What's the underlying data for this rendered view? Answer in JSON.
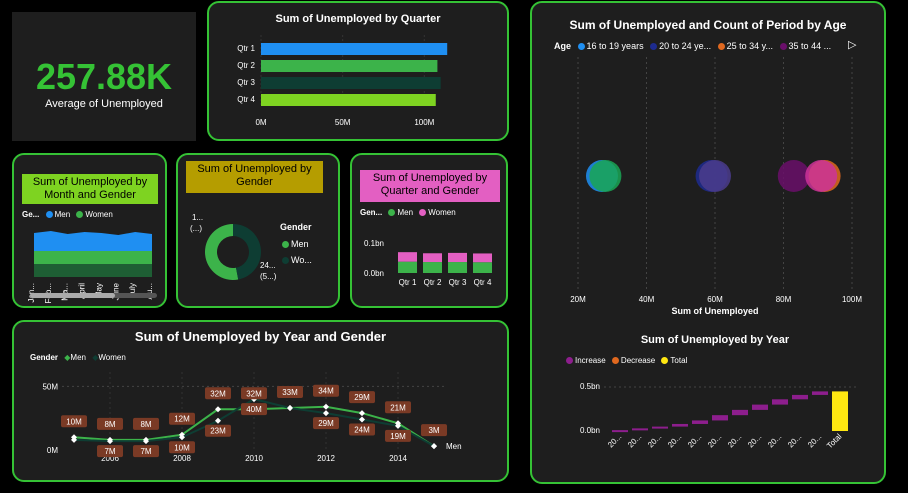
{
  "kpi": {
    "value": "257.88K",
    "label": "Average of Unemployed"
  },
  "colors": {
    "accent_green": "#35c235",
    "men": "#3cb34a",
    "women": "#0e3d33",
    "increase": "#8d1e8d",
    "decrease": "#e0681f",
    "total": "#ffe711"
  },
  "quarter_chart": {
    "title": "Sum of Unemployed by Quarter",
    "chart_data": {
      "type": "bar",
      "categories": [
        "Qtr 1",
        "Qtr 2",
        "Qtr 3",
        "Qtr 4"
      ],
      "values": [
        114,
        108,
        110,
        107
      ],
      "colors": [
        "#1f8ff2",
        "#3cb34a",
        "#0e3d33",
        "#7ed321"
      ],
      "xticks": [
        "0M",
        "50M",
        "100M"
      ],
      "xlim": [
        0,
        120
      ]
    }
  },
  "month_gender": {
    "title": "Sum of Unemployed by Month and Gender",
    "legend_title": "Ge...",
    "legend": [
      "Men",
      "Women"
    ],
    "months": [
      "Jan...",
      "Feb...",
      "Ma...",
      "April",
      "May",
      "June",
      "July",
      "Au..."
    ]
  },
  "donut": {
    "title": "Sum of Unemployed by Gender",
    "label_men": "24...",
    "label_men2": "(5...)",
    "label_women": "1...",
    "label_women2": "(...)",
    "legend_title": "Gender",
    "legend": [
      "Men",
      "Wo..."
    ],
    "chart_data": {
      "type": "pie",
      "categories": [
        "Men",
        "Women"
      ],
      "values": [
        53,
        47
      ]
    }
  },
  "qtr_gender": {
    "title": "Sum of Unemployed by Quarter and Gender",
    "legend_title": "Gen...",
    "legend": [
      "Men",
      "Women"
    ],
    "yticks": [
      "0.1bn",
      "0.0bn"
    ],
    "chart_data": {
      "type": "bar",
      "categories": [
        "Qtr 1",
        "Qtr 2",
        "Qtr 3",
        "Qtr 4"
      ],
      "series": [
        {
          "name": "Men",
          "values": [
            0.062,
            0.06,
            0.06,
            0.059
          ]
        },
        {
          "name": "Women",
          "values": [
            0.052,
            0.048,
            0.05,
            0.048
          ]
        }
      ]
    }
  },
  "bubble": {
    "title": "Sum of Unemployed and Count of Period by Age",
    "legend_title": "Age",
    "legend": [
      "16 to 19 years",
      "20 to 24 ye...",
      "25 to 34 y...",
      "35 to 44 ..."
    ],
    "xticks": [
      "20M",
      "40M",
      "60M",
      "80M",
      "100M"
    ],
    "xlabel": "Sum of Unemployed",
    "chart_data": {
      "type": "scatter",
      "xlim": [
        20,
        100
      ],
      "points": [
        {
          "x": 27,
          "y": 1,
          "color": "#1f8ff2"
        },
        {
          "x": 28,
          "y": 1,
          "color": "#1aa655"
        },
        {
          "x": 59,
          "y": 1,
          "color": "#1d2b8f"
        },
        {
          "x": 60,
          "y": 1,
          "color": "#4b3c8c"
        },
        {
          "x": 83,
          "y": 1,
          "color": "#6a0f6a"
        },
        {
          "x": 92,
          "y": 1,
          "color": "#e0681f"
        },
        {
          "x": 91,
          "y": 1,
          "color": "#cc3399"
        }
      ]
    }
  },
  "year_gender": {
    "title": "Sum of Unemployed by Year and Gender",
    "legend_title": "Gender",
    "legend": [
      "Men",
      "Women"
    ],
    "yticks": [
      "50M",
      "0M"
    ],
    "xticks": [
      "2006",
      "2008",
      "2010",
      "2012",
      "2014"
    ],
    "end_label": "Men",
    "chart_data": {
      "type": "line",
      "x": [
        2005,
        2006,
        2007,
        2008,
        2009,
        2010,
        2011,
        2012,
        2013,
        2014,
        2015
      ],
      "ylim": [
        0,
        55
      ],
      "series": [
        {
          "name": "Men",
          "values": [
            10,
            8,
            8,
            12,
            32,
            32,
            33,
            34,
            29,
            21,
            3
          ],
          "labels": [
            "10M",
            "8M",
            "8M",
            "12M",
            "32M",
            "32M",
            "33M",
            "34M",
            "29M",
            "21M",
            "3M"
          ]
        },
        {
          "name": "Women",
          "values": [
            8,
            7,
            7,
            10,
            23,
            40,
            33,
            29,
            24,
            19,
            3
          ],
          "labels": [
            "",
            "7M",
            "7M",
            "10M",
            "23M",
            "40M",
            "",
            "29M",
            "24M",
            "19M",
            ""
          ]
        }
      ]
    }
  },
  "waterfall": {
    "title": "Sum of Unemployed by Year",
    "legend": [
      "Increase",
      "Decrease",
      "Total"
    ],
    "yticks": [
      "0.5bn",
      "0.0bn"
    ],
    "xlabels": [
      "20...",
      "20...",
      "20...",
      "20...",
      "20...",
      "20...",
      "20...",
      "20...",
      "20...",
      "20...",
      "20...",
      "Total"
    ],
    "chart_data": {
      "type": "bar",
      "categories": [
        "20...",
        "20...",
        "20...",
        "20...",
        "20...",
        "20...",
        "20...",
        "20...",
        "20...",
        "20...",
        "20...",
        "Total"
      ],
      "values": [
        0.01,
        0.02,
        0.02,
        0.03,
        0.04,
        0.06,
        0.06,
        0.06,
        0.06,
        0.05,
        0.04,
        0.45
      ],
      "ylim": [
        0,
        0.5
      ]
    }
  }
}
